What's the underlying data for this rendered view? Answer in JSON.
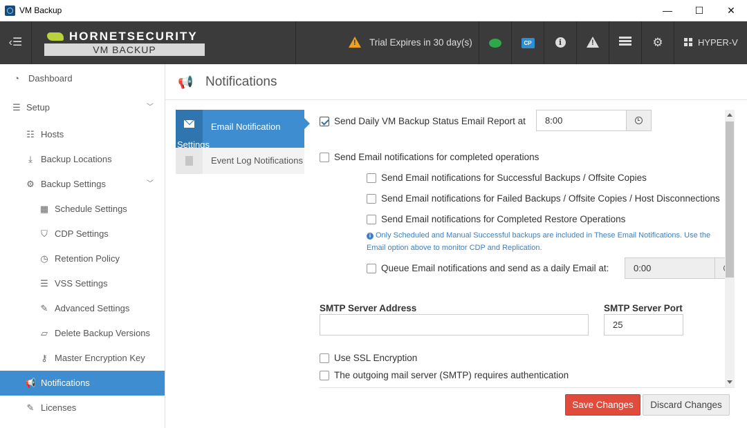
{
  "window": {
    "title": "VM Backup",
    "min_glyph": "—",
    "max_glyph": "☐",
    "close_glyph": "✕"
  },
  "appbar": {
    "logo_top": "HORNETSECURITY",
    "logo_bottom": "VM BACKUP",
    "trial_text": "Trial Expires in 30 day(s)",
    "cp_label": "CP",
    "host_label": "HYPER-V",
    "icons": [
      "menu-icon",
      "warning-icon",
      "chat-icon",
      "cp-icon",
      "info-icon",
      "alert-icon",
      "server-icon",
      "gears-icon",
      "windows-icon"
    ]
  },
  "sidebar": {
    "items": [
      {
        "label": "Dashboard",
        "icon": "dashboard-icon"
      },
      {
        "label": "Setup",
        "icon": "sliders-icon"
      },
      {
        "label": "Hosts",
        "icon": "list-icon"
      },
      {
        "label": "Backup Locations",
        "icon": "download-icon"
      },
      {
        "label": "Backup Settings",
        "icon": "gears-icon"
      },
      {
        "label": "Schedule Settings",
        "icon": "calendar-icon"
      },
      {
        "label": "CDP Settings",
        "icon": "shield-icon"
      },
      {
        "label": "Retention Policy",
        "icon": "clock-icon"
      },
      {
        "label": "VSS Settings",
        "icon": "list-icon"
      },
      {
        "label": "Advanced Settings",
        "icon": "wrench-icon"
      },
      {
        "label": "Delete Backup Versions",
        "icon": "eraser-icon"
      },
      {
        "label": "Master Encryption Key",
        "icon": "key-icon"
      },
      {
        "label": "Notifications",
        "icon": "bullhorn-icon"
      },
      {
        "label": "Licenses",
        "icon": "edit-icon"
      }
    ],
    "active": "Notifications"
  },
  "page": {
    "title": "Notifications",
    "tabs": [
      {
        "label": "Email Notification Settings",
        "active": true
      },
      {
        "label": "Event Log Notifications",
        "active": false
      }
    ]
  },
  "form": {
    "daily_report_label": "Send Daily VM Backup Status Email Report at",
    "daily_report_checked": true,
    "daily_report_time": "8:00",
    "completed_ops_label": "Send Email notifications for completed operations",
    "completed_ops_checked": false,
    "successful_label": "Send Email notifications for Successful Backups / Offsite Copies",
    "failed_label": "Send Email notifications for Failed Backups / Offsite Copies / Host Disconnections",
    "restore_label": "Send Email notifications for Completed Restore Operations",
    "info_note": "Only Scheduled and Manual Successful backups are included in These Email Notifications. Use the Email option above to monitor CDP and Replication.",
    "queue_label": "Queue Email notifications and send as a daily Email at:",
    "queue_time": "0:00",
    "smtp_address_label": "SMTP Server Address",
    "smtp_address_value": "",
    "smtp_port_label": "SMTP Server Port",
    "smtp_port_value": "25",
    "ssl_label": "Use SSL Encryption",
    "auth_label": "The outgoing mail server (SMTP) requires authentication"
  },
  "buttons": {
    "save": "Save Changes",
    "discard": "Discard Changes"
  },
  "colors": {
    "accent": "#3d8dd0",
    "save": "#e14b3b",
    "appbar": "#3b3b3b"
  }
}
